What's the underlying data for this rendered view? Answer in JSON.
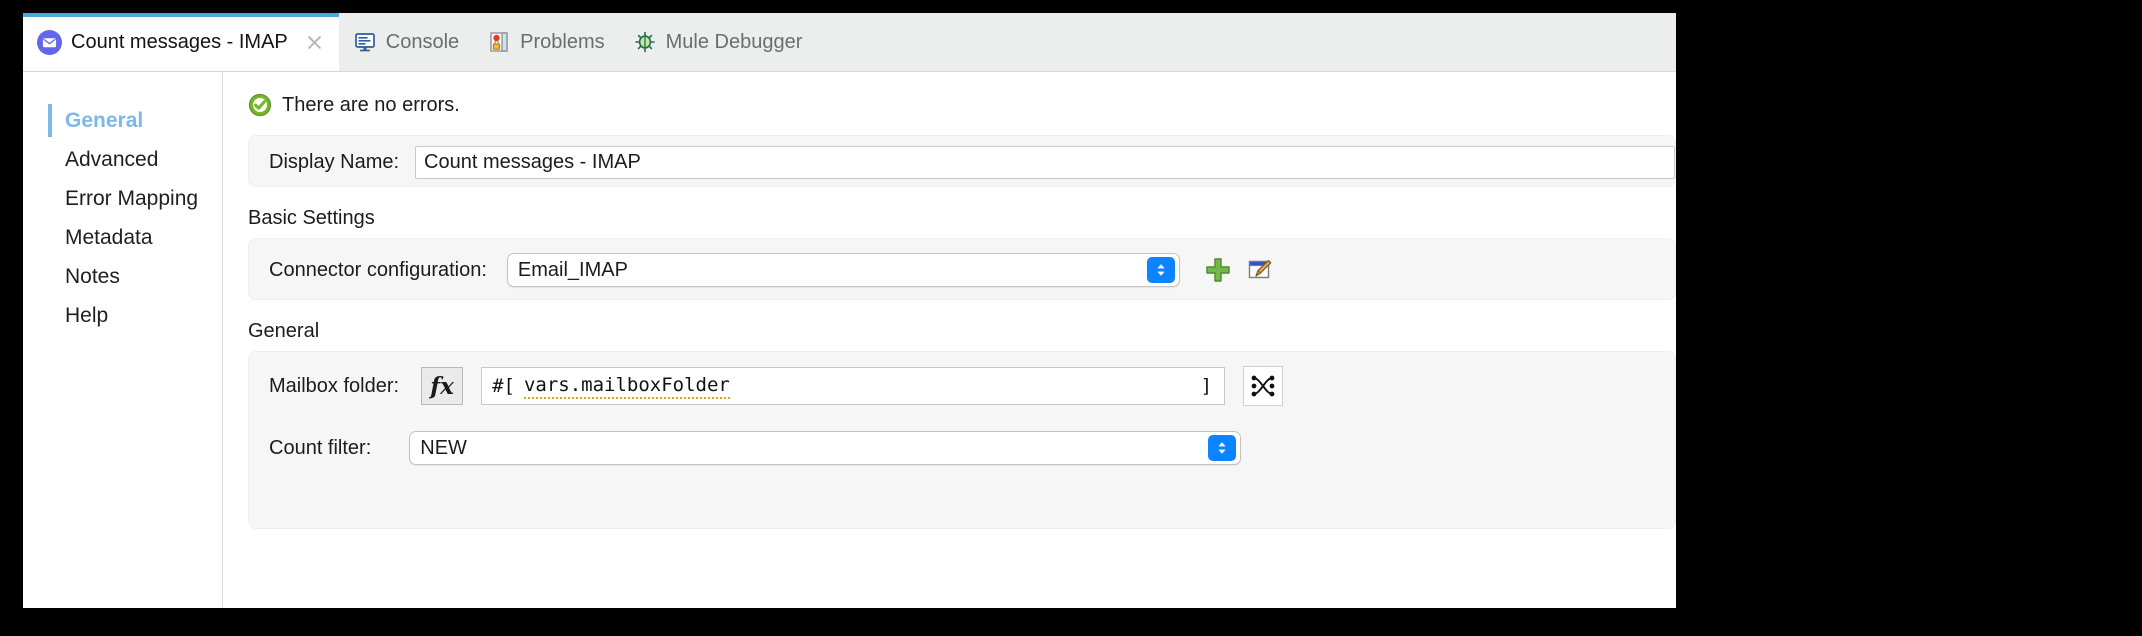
{
  "window": {
    "tabs": [
      {
        "label": "Count messages - IMAP",
        "icon": "envelope-icon",
        "active": true,
        "closable": true
      },
      {
        "label": "Console",
        "icon": "console-icon",
        "active": false,
        "closable": false
      },
      {
        "label": "Problems",
        "icon": "problems-icon",
        "active": false,
        "closable": false
      },
      {
        "label": "Mule Debugger",
        "icon": "debugger-icon",
        "active": false,
        "closable": false
      }
    ]
  },
  "sidebar": {
    "items": [
      {
        "label": "General",
        "selected": true
      },
      {
        "label": "Advanced",
        "selected": false
      },
      {
        "label": "Error Mapping",
        "selected": false
      },
      {
        "label": "Metadata",
        "selected": false
      },
      {
        "label": "Notes",
        "selected": false
      },
      {
        "label": "Help",
        "selected": false
      }
    ]
  },
  "main": {
    "status": {
      "text": "There are no errors.",
      "icon": "success-check-icon"
    },
    "display_name": {
      "label": "Display Name:",
      "value": "Count messages - IMAP"
    },
    "basic_settings": {
      "title": "Basic Settings",
      "connector_configuration": {
        "label": "Connector configuration:",
        "value": "Email_IMAP",
        "add_icon": "plus-icon",
        "edit_icon": "edit-pencil-icon"
      }
    },
    "general": {
      "title": "General",
      "mailbox_folder": {
        "label": "Mailbox folder:",
        "fx_label": "fx",
        "expression_open": "#[",
        "expression_value": "vars.mailboxFolder",
        "expression_close": "]",
        "mapping_icon": "dataweave-mapping-icon"
      },
      "count_filter": {
        "label": "Count filter:",
        "value": "NEW"
      }
    }
  },
  "colors": {
    "accent_tab": "#4aa8e0",
    "selected_nav": "#7cb9e8",
    "stepper_blue": "#0a84ff",
    "success_green": "#76b82a",
    "envelope_purple": "#6366e8",
    "expression_underline": "#e0a020"
  }
}
